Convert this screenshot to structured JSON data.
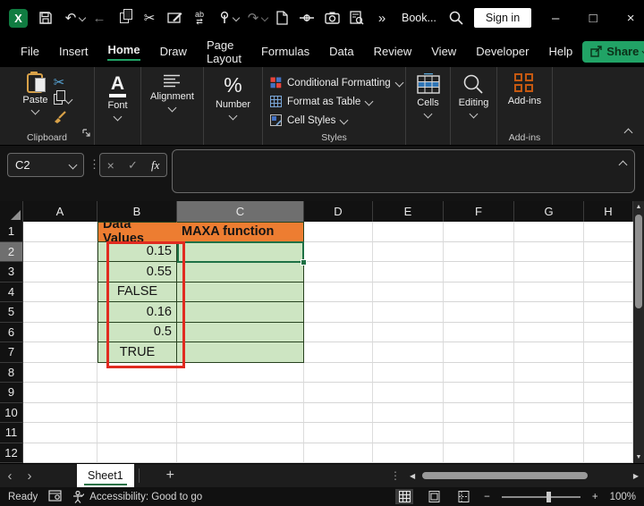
{
  "colors": {
    "accent_green": "#21A366",
    "selection_green": "#1E7145",
    "header_orange": "#ED7D31",
    "cell_green": "#CDE5C2",
    "annotation_red": "#E02B20"
  },
  "titlebar": {
    "doc_title": "Book...",
    "sign_in": "Sign in",
    "overflow": "»",
    "logo": "X"
  },
  "glyphs": {
    "undo": "↶",
    "redo": "↷",
    "back": "←",
    "cut": "✂",
    "dots": "⋮",
    "minimize": "–",
    "maximize": "□",
    "close": "×",
    "cancel": "×",
    "enter": "✓",
    "fx": "fx",
    "percent": "%",
    "font_a": "A",
    "prev": "‹",
    "next": "›",
    "plus": "+",
    "scroll_left": "◀",
    "scroll_right": "▶",
    "scroll_up": "▲",
    "scroll_down": "▼",
    "zoom_out": "−",
    "zoom_in": "+",
    "replace": "ab\n⇄"
  },
  "menubar": {
    "tabs": [
      "File",
      "Insert",
      "Home",
      "Draw",
      "Page Layout",
      "Formulas",
      "Data",
      "Review",
      "View",
      "Developer",
      "Help"
    ],
    "active": "Home",
    "share": "Share"
  },
  "ribbon": {
    "paste": "Paste",
    "clipboard_label": "Clipboard",
    "font": "Font",
    "alignment": "Alignment",
    "number": "Number",
    "styles": [
      "Conditional Formatting",
      "Format as Table",
      "Cell Styles"
    ],
    "styles_label": "Styles",
    "cells": "Cells",
    "editing": "Editing",
    "addins": "Add-ins",
    "addins_label": "Add-ins"
  },
  "formula": {
    "name_box": "C2",
    "input_value": ""
  },
  "sheet": {
    "columns": [
      "A",
      "B",
      "C",
      "D",
      "E",
      "F",
      "G",
      "H"
    ],
    "rows": [
      "1",
      "2",
      "3",
      "4",
      "5",
      "6",
      "7",
      "8",
      "9",
      "10",
      "11",
      "12"
    ],
    "b1": "Data Values",
    "c1": "MAXA function",
    "values": [
      "0.15",
      "0.55",
      "FALSE",
      "0.16",
      "0.5",
      "TRUE"
    ]
  },
  "tabbar": {
    "sheet": "Sheet1"
  },
  "statusbar": {
    "ready": "Ready",
    "accessibility": "Accessibility: Good to go",
    "zoom": "100%"
  }
}
